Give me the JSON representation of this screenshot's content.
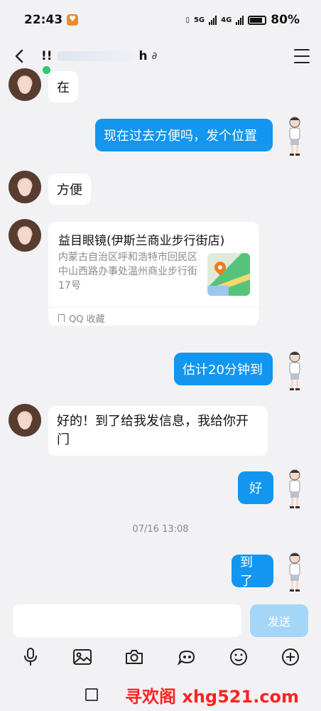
{
  "status_bar": {
    "time": "22:43",
    "network_a": "5G",
    "network_b": "4G",
    "battery": "80%"
  },
  "header": {
    "title_fragment_left": "!!",
    "title_fragment_right": "h",
    "back_icon": "chevron-left-icon",
    "menu_icon": "hamburger-icon"
  },
  "messages": [
    {
      "side": "left",
      "text": "在"
    },
    {
      "side": "right",
      "text": "现在过去方便吗，发个位置"
    },
    {
      "side": "left",
      "text": "方便"
    },
    {
      "side": "left",
      "type": "location",
      "title": "益目眼镜(伊斯兰商业步行街店)",
      "address": "内蒙古自治区呼和浩特市回民区中山西路办事处温州商业步行街17号",
      "footer": "QQ 收藏"
    },
    {
      "side": "right",
      "text": "估计20分钟到"
    },
    {
      "side": "left",
      "text": "好的！到了给我发信息，我给你开门"
    },
    {
      "side": "right",
      "text": "好"
    },
    {
      "side": "right",
      "text": "到了"
    }
  ],
  "timestamp": "07/16 13:08",
  "input": {
    "value": "",
    "send_label": "发送"
  },
  "toolbar": [
    "microphone-icon",
    "image-icon",
    "camera-icon",
    "red-packet-icon",
    "emoji-icon",
    "plus-icon"
  ],
  "watermark": "寻欢阁 xhg521.com",
  "colors": {
    "bubble_self": "#1296f0",
    "bubble_other": "#ffffff",
    "send_disabled": "#a4d6f7",
    "online": "#2dc96a"
  }
}
